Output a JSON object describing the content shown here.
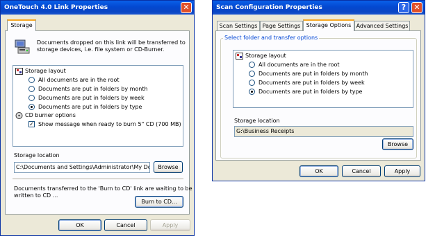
{
  "left_dialog": {
    "title": "OneTouch 4.0 Link Properties",
    "close_icon": "close-icon",
    "tab_storage": "Storage",
    "description": [
      "Documents dropped on this link will be transferred to",
      "storage devices, i.e. file system or CD-Burner."
    ],
    "tree": {
      "storage_layout": "Storage layout",
      "options": [
        {
          "label": "All documents are in the root",
          "selected": false
        },
        {
          "label": "Documents are put in folders by month",
          "selected": false
        },
        {
          "label": "Documents are put in folders by week",
          "selected": false
        },
        {
          "label": "Documents are put in folders by type",
          "selected": true
        }
      ],
      "cd_burner_options": "CD burner options",
      "show_message": "Show message when ready to burn 5\" CD (700 MB)",
      "show_message_checked": true
    },
    "storage_location_label": "Storage location",
    "storage_location_value": "C:\\Documents and Settings\\Administrator\\My Do",
    "browse": "Browse",
    "burn_message": [
      "Documents transferred to the 'Burn to CD' link are waiting to be",
      "written to CD ..."
    ],
    "burn_to_cd": "Burn to CD...",
    "ok": "OK",
    "cancel": "Cancel",
    "apply": "Apply"
  },
  "right_dialog": {
    "title": "Scan Configuration Properties",
    "help_icon": "help-icon",
    "close_icon": "close-icon",
    "tabs": [
      "Scan Settings",
      "Page Settings",
      "Storage Options",
      "Advanced Settings"
    ],
    "active_tab": "Storage Options",
    "group_label": "Select folder and transfer options",
    "tree": {
      "storage_layout": "Storage layout",
      "options": [
        {
          "label": "All documents are in the root",
          "selected": false
        },
        {
          "label": "Documents are put in folders by month",
          "selected": false
        },
        {
          "label": "Documents are put in folders by week",
          "selected": false
        },
        {
          "label": "Documents are put in folders by type",
          "selected": true
        }
      ]
    },
    "storage_location_label": "Storage location",
    "storage_location_value": "G:\\Business Receipts",
    "browse": "Browse",
    "ok": "OK",
    "cancel": "Cancel",
    "apply": "Apply"
  }
}
